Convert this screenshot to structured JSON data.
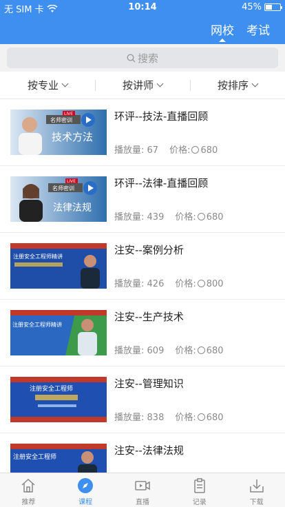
{
  "status": {
    "carrier": "无 SIM 卡",
    "time": "10:14",
    "battery": "45%",
    "battery_level": 0.45
  },
  "nav": {
    "tabs": [
      {
        "label": "网校",
        "active": true
      },
      {
        "label": "考试",
        "active": false
      }
    ]
  },
  "search": {
    "placeholder": "搜索"
  },
  "filters": [
    "按专业",
    "按讲师",
    "按排序"
  ],
  "list": {
    "play_label": "播放量:",
    "price_label": "价格:",
    "items": [
      {
        "title": "环评--技法-直播回顾",
        "plays": "67",
        "price": "680",
        "thumb_text": "技术方法"
      },
      {
        "title": "环评--法律-直播回顾",
        "plays": "439",
        "price": "680",
        "thumb_text": "法律法规"
      },
      {
        "title": "注安--案例分析",
        "plays": "426",
        "price": "800",
        "thumb_text": "注册安全工程师精讲"
      },
      {
        "title": "注安--生产技术",
        "plays": "609",
        "price": "680",
        "thumb_text": "注册安全工程师精讲"
      },
      {
        "title": "注安--管理知识",
        "plays": "838",
        "price": "680",
        "thumb_text": "注册安全工程师"
      },
      {
        "title": "注安--法律法规",
        "plays": "",
        "price": "",
        "thumb_text": "注册安全工程师"
      }
    ]
  },
  "tabbar": [
    {
      "label": "推荐",
      "icon": "home-icon",
      "active": false
    },
    {
      "label": "课程",
      "icon": "compass-icon",
      "active": true
    },
    {
      "label": "直播",
      "icon": "video-icon",
      "active": false
    },
    {
      "label": "记录",
      "icon": "clipboard-icon",
      "active": false
    },
    {
      "label": "下载",
      "icon": "download-icon",
      "active": false
    }
  ],
  "colors": {
    "primary": "#3f8ff0",
    "text": "#222222",
    "muted": "#8a8a8a"
  }
}
